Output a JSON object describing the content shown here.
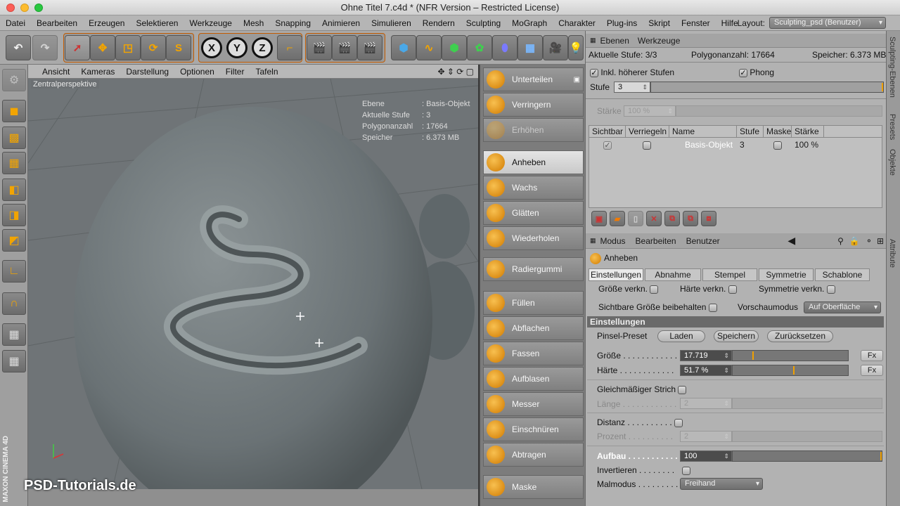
{
  "window": {
    "title": "Ohne Titel 7.c4d * (NFR Version – Restricted License)"
  },
  "menu": [
    "Datei",
    "Bearbeiten",
    "Erzeugen",
    "Selektieren",
    "Werkzeuge",
    "Mesh",
    "Snapping",
    "Animieren",
    "Simulieren",
    "Rendern",
    "Sculpting",
    "MoGraph",
    "Charakter",
    "Plug-ins",
    "Skript",
    "Fenster",
    "Hilfe"
  ],
  "layout": {
    "label": "Layout:",
    "value": "Sculpting_psd (Benutzer)"
  },
  "toolbar": {
    "axis_x": "X",
    "axis_y": "Y",
    "axis_z": "Z"
  },
  "viewport": {
    "menu": [
      "Ansicht",
      "Kameras",
      "Darstellung",
      "Optionen",
      "Filter",
      "Tafeln"
    ],
    "view_name": "Zentralperspektive",
    "hud": [
      {
        "k": "Ebene",
        "v": ": Basis-Objekt"
      },
      {
        "k": "Aktuelle Stufe",
        "v": ": 3"
      },
      {
        "k": "Polygonanzahl",
        "v": ": 17664"
      },
      {
        "k": "Speicher",
        "v": ": 6.373 MB"
      }
    ],
    "brand": "MAXON CINEMA 4D",
    "watermark": "PSD-Tutorials.de"
  },
  "sculpt_tools": [
    "Unterteilen",
    "Verringern",
    "Erhöhen",
    "Anheben",
    "Wachs",
    "Glätten",
    "Wiederholen",
    "Radiergummi",
    "Füllen",
    "Abflachen",
    "Fassen",
    "Aufblasen",
    "Messer",
    "Einschnüren",
    "Abtragen",
    "Maske"
  ],
  "layers_panel": {
    "menu": [
      "Ebenen",
      "Werkzeuge"
    ],
    "info": {
      "stufe": "Aktuelle Stufe: 3/3",
      "poly": "Polygonanzahl: 17664",
      "speicher": "Speicher: 6.373 MB"
    },
    "inkl": "Inkl. höherer Stufen",
    "phong": "Phong",
    "stufe_label": "Stufe",
    "stufe_value": "3",
    "staerke_label": "Stärke",
    "staerke_value": "100 %",
    "columns": [
      "Sichtbar",
      "Verriegeln",
      "Name",
      "Stufe",
      "Maske",
      "Stärke"
    ],
    "row": {
      "name": "Basis-Objekt",
      "stufe": "3",
      "staerke": "100 %"
    }
  },
  "attr_panel": {
    "menu": [
      "Modus",
      "Bearbeiten",
      "Benutzer"
    ],
    "tool_name": "Anheben",
    "tabs": [
      "Einstellungen",
      "Abnahme",
      "Stempel",
      "Symmetrie",
      "Schablone"
    ],
    "groesse_verkn": "Größe verkn.",
    "haerte_verkn": "Härte verkn.",
    "symmetrie_verkn": "Symmetrie verkn.",
    "sichtbare": "Sichtbare Größe beibehalten",
    "vorschau_label": "Vorschaumodus",
    "vorschau_value": "Auf Oberfläche",
    "section": "Einstellungen",
    "preset_label": "Pinsel-Preset",
    "laden": "Laden",
    "speichern": "Speichern",
    "zuruecksetzen": "Zurücksetzen",
    "groesse_label": "Größe . . . . . . . . . . . .",
    "groesse_value": "17.719",
    "haerte_label": "Härte . . . . . . . . . . . .",
    "haerte_value": "51.7 %",
    "fx": "Fx",
    "gleich": "Gleichmäßiger Strich",
    "laenge_label": "Länge . . . . . . . . . . . .",
    "laenge_value": "2",
    "distanz_label": "Distanz . . . . . . . . . .",
    "prozent_label": "Prozent . . . . . . . . . .",
    "prozent_value": "2",
    "aufbau_label": "Aufbau . . . . . . . . . . .",
    "aufbau_value": "100",
    "invertieren_label": "Invertieren . . . . . . . .",
    "malmodus_label": "Malmodus . . . . . . . . .",
    "malmodus_value": "Freihand"
  },
  "side_tabs": [
    "Sculpting-Ebenen",
    "Presets",
    "Objekte",
    "Attribute"
  ],
  "colors": {
    "accent": "#f0a000",
    "viewport_bg": "#6f7477"
  }
}
